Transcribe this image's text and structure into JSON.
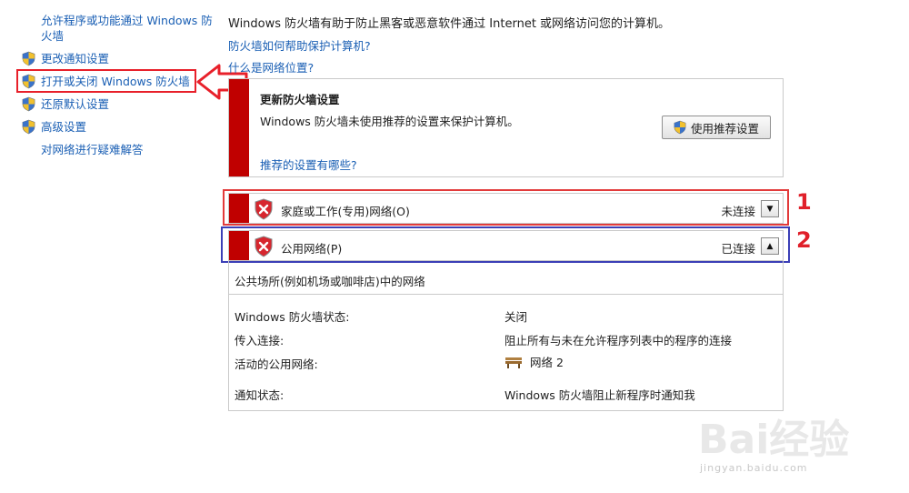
{
  "sidebar": {
    "items": [
      {
        "label": "允许程序或功能通过 Windows 防火墙",
        "icon": "none"
      },
      {
        "label": "更改通知设置",
        "icon": "uac-shield-icon"
      },
      {
        "label": "打开或关闭 Windows 防火墙",
        "icon": "uac-shield-icon"
      },
      {
        "label": "还原默认设置",
        "icon": "uac-shield-icon"
      },
      {
        "label": "高级设置",
        "icon": "uac-shield-icon"
      },
      {
        "label": "对网络进行疑难解答",
        "icon": "none"
      }
    ]
  },
  "main": {
    "intro": "Windows 防火墙有助于防止黑客或恶意软件通过 Internet 或网络访问您的计算机。",
    "help_link_1": "防火墙如何帮助保护计算机?",
    "help_link_2": "什么是网络位置?",
    "update_panel": {
      "title": "更新防火墙设置",
      "text": "Windows 防火墙未使用推荐的设置来保护计算机。",
      "link": "推荐的设置有哪些?",
      "button": "使用推荐设置"
    },
    "networks": [
      {
        "name": "家庭或工作(专用)网络(O)",
        "status": "未连接",
        "toggle": "▼"
      },
      {
        "name": "公用网络(P)",
        "status": "已连接",
        "toggle": "▲"
      }
    ],
    "public_detail": {
      "description": "公共场所(例如机场或咖啡店)中的网络",
      "rows": [
        {
          "label": "Windows 防火墙状态:",
          "value": "关闭"
        },
        {
          "label": "传入连接:",
          "value": "阻止所有与未在允许程序列表中的程序的连接"
        },
        {
          "label": "活动的公用网络:",
          "value": "网络  2"
        },
        {
          "label": "通知状态:",
          "value": "Windows 防火墙阻止新程序时通知我"
        }
      ]
    }
  },
  "annotations": {
    "label_1": "1",
    "label_2": "2"
  },
  "watermark": {
    "text": "Bai经验",
    "sub": "jingyan.baidu.com"
  },
  "colors": {
    "link": "#1a5fb4",
    "red_bar": "#c00000",
    "highlight_red": "#e8202a",
    "highlight_blue": "#3b3fb6"
  }
}
